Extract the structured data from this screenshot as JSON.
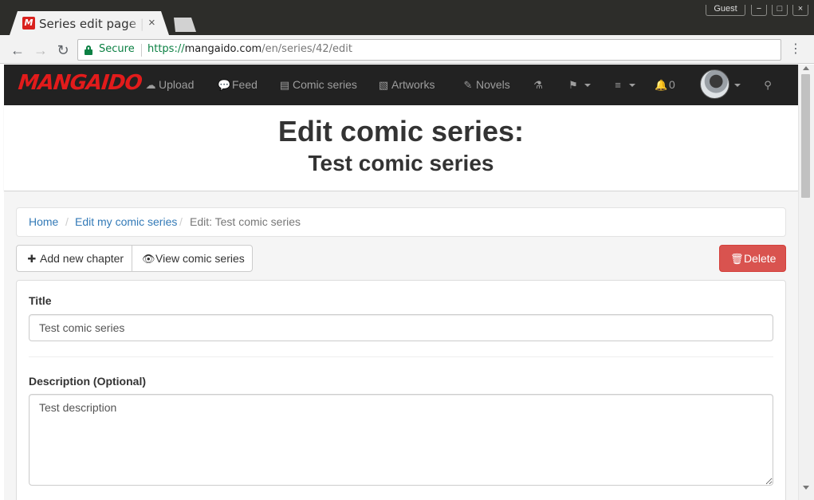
{
  "browser": {
    "tab_title": "Series edit page | Mangaido",
    "tab_close": "×",
    "favicon_letter": "M",
    "guest_label": "Guest",
    "window_controls": {
      "minimize": "−",
      "maximize": "□",
      "close": "×"
    },
    "secure_label": "Secure",
    "url": {
      "scheme": "https://",
      "host": "mangaido.com",
      "path": "/en/series/42/edit"
    },
    "menu_icon": "⋮",
    "back_icon": "←",
    "forward_icon": "→",
    "reload_icon": "↻"
  },
  "navbar": {
    "logo": "MANGAIDO",
    "items": [
      {
        "icon": "☁",
        "label": "Upload"
      },
      {
        "icon": "💬",
        "label": "Feed"
      },
      {
        "icon": "▤",
        "label": "Comic series"
      },
      {
        "icon": "▧",
        "label": "Artworks"
      },
      {
        "icon": "✎",
        "label": "Novels"
      }
    ],
    "potion_icon": "⚗",
    "flag_icon": "⚑",
    "menu_icon": "≡",
    "bell_icon": "🔔",
    "notification_count": "0",
    "search_icon": "⚲"
  },
  "header": {
    "title": "Edit comic series:",
    "subtitle": "Test comic series"
  },
  "breadcrumb": {
    "separator": "/",
    "items": [
      {
        "label": "Home"
      },
      {
        "label": "Edit my comic series"
      },
      {
        "label": "Edit: Test comic series"
      }
    ]
  },
  "actions": {
    "add_chapter_icon": "✚",
    "add_chapter": "Add new chapter",
    "view_series_icon": "👁",
    "view_series": "View comic series",
    "delete_icon": "🗑",
    "delete": "Delete"
  },
  "form": {
    "title_label": "Title",
    "title_value": "Test comic series",
    "description_label": "Description (Optional)",
    "description_value": "Test description"
  },
  "colors": {
    "navbar_bg": "#222222",
    "logo": "#e21b1b",
    "link": "#337ab7",
    "danger": "#d9534f",
    "secure": "#0b8043"
  }
}
